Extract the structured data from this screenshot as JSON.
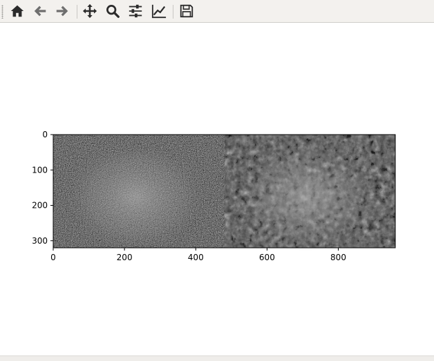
{
  "toolbar": {
    "buttons": [
      {
        "name": "home-button",
        "icon": "home-icon"
      },
      {
        "name": "back-button",
        "icon": "arrow-left-icon"
      },
      {
        "name": "forward-button",
        "icon": "arrow-right-icon"
      },
      {
        "name": "pan-button",
        "icon": "move-icon"
      },
      {
        "name": "zoom-button",
        "icon": "magnifier-icon"
      },
      {
        "name": "configure-subplots-button",
        "icon": "sliders-icon"
      },
      {
        "name": "edit-axes-button",
        "icon": "line-chart-icon"
      },
      {
        "name": "save-button",
        "icon": "floppy-disk-icon"
      }
    ],
    "icon_color": "#2b2b2b"
  },
  "chart_data": {
    "type": "image",
    "image_extent": {
      "x": [
        0,
        960
      ],
      "y": [
        320,
        0
      ]
    },
    "panels": [
      "noisy grayscale",
      "clean grayscale"
    ],
    "xticks": [
      "0",
      "200",
      "400",
      "600",
      "800"
    ],
    "yticks": [
      "0",
      "100",
      "200",
      "300"
    ],
    "xlim": [
      0,
      960
    ],
    "ylim": [
      320,
      0
    ],
    "grid": false
  }
}
